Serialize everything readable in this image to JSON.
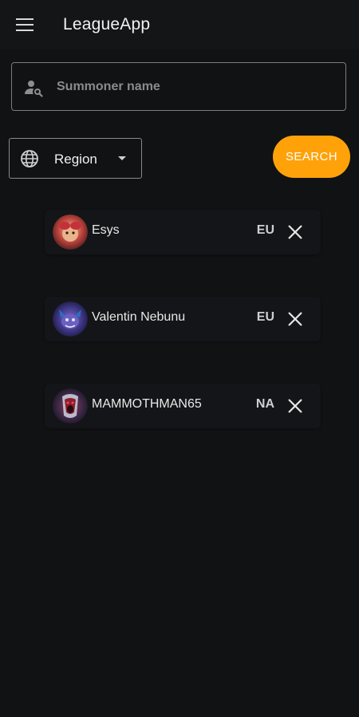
{
  "appbar": {
    "title": "LeagueApp",
    "menu_icon": "hamburger-menu-icon"
  },
  "search": {
    "placeholder": "Summoner name",
    "value": "",
    "icon": "person-search-icon"
  },
  "region_select": {
    "selected": "Region",
    "icon": "globe-icon",
    "caret_icon": "caret-down-icon"
  },
  "search_button": {
    "label": "SEARCH",
    "color": "#ffa20a"
  },
  "history": [
    {
      "name": "Esys",
      "region": "EU",
      "avatar_icon": "champion-avatar-icon",
      "remove_icon": "close-icon"
    },
    {
      "name": "Valentin Nebunu",
      "region": "EU",
      "avatar_icon": "champion-avatar-icon",
      "remove_icon": "close-icon"
    },
    {
      "name": "MAMMOTHMAN65",
      "region": "NA",
      "avatar_icon": "champion-avatar-icon",
      "remove_icon": "close-icon"
    }
  ],
  "colors": {
    "background": "#111214",
    "accent": "#ffa20a",
    "border": "#7c7c80"
  }
}
